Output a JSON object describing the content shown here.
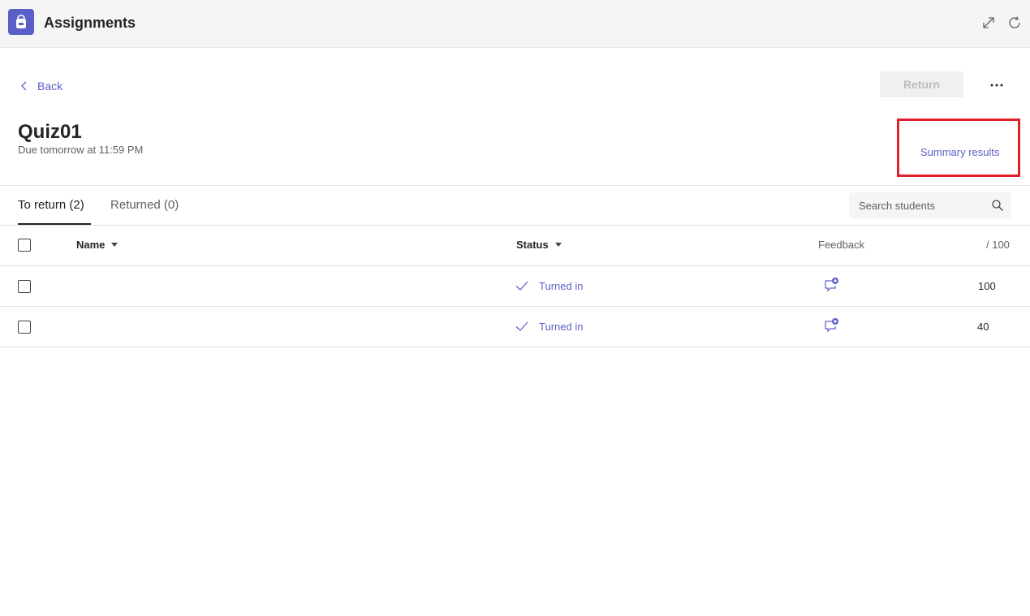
{
  "header": {
    "app_title": "Assignments",
    "app_icon": "backpack-icon",
    "expand_icon": "expand-icon",
    "refresh_icon": "refresh-icon"
  },
  "nav": {
    "back_label": "Back"
  },
  "actions": {
    "return_label": "Return",
    "more_icon": "more-icon"
  },
  "assignment": {
    "title": "Quiz01",
    "due": "Due tomorrow at 11:59 PM",
    "summary_link": "Summary results"
  },
  "tabs": [
    {
      "label": "To return (2)",
      "active": true
    },
    {
      "label": "Returned (0)",
      "active": false
    }
  ],
  "search": {
    "placeholder": "Search students"
  },
  "table": {
    "columns": {
      "name": "Name",
      "status": "Status",
      "feedback": "Feedback",
      "score": "/ 100"
    },
    "rows": [
      {
        "name": "",
        "status": "Turned in",
        "score": "100"
      },
      {
        "name": "",
        "status": "Turned in",
        "score": "40"
      }
    ]
  },
  "colors": {
    "accent": "#5b5fc7",
    "highlight": "#e0212c",
    "return_disabled_bg": "#f0f0f0"
  }
}
